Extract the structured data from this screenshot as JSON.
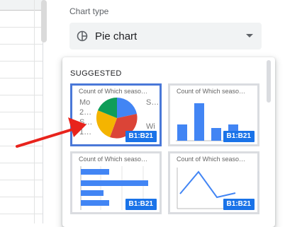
{
  "editor": {
    "chart_type_label": "Chart type",
    "selected_chart_type": "Pie chart",
    "suggested_heading": "SUGGESTED"
  },
  "thumbnails": [
    {
      "title": "Count of Which seaso…",
      "range": "B1:B21",
      "type": "pie",
      "legend_left": [
        "Mo",
        "2…",
        "S…",
        "1…"
      ],
      "legend_right": [
        "S…",
        "Wi"
      ],
      "selected": true
    },
    {
      "title": "Count of Which seaso…",
      "range": "B1:B21",
      "type": "column",
      "selected": false
    },
    {
      "title": "Count of Which seaso…",
      "range": "B1:B21",
      "type": "bar",
      "selected": false
    },
    {
      "title": "Count of Which seaso…",
      "range": "B1:B21",
      "type": "line",
      "selected": false
    }
  ],
  "colors": {
    "blue": "#4285f4",
    "red": "#db4437",
    "yellow": "#f4b400",
    "green": "#0f9d58",
    "selected_border": "#4a78d8",
    "range_badge": "#1a73e8",
    "annotation_arrow": "#e8231c"
  },
  "icons": {
    "chart_type": "pie-chart-icon",
    "dropdown": "caret-down-icon"
  }
}
